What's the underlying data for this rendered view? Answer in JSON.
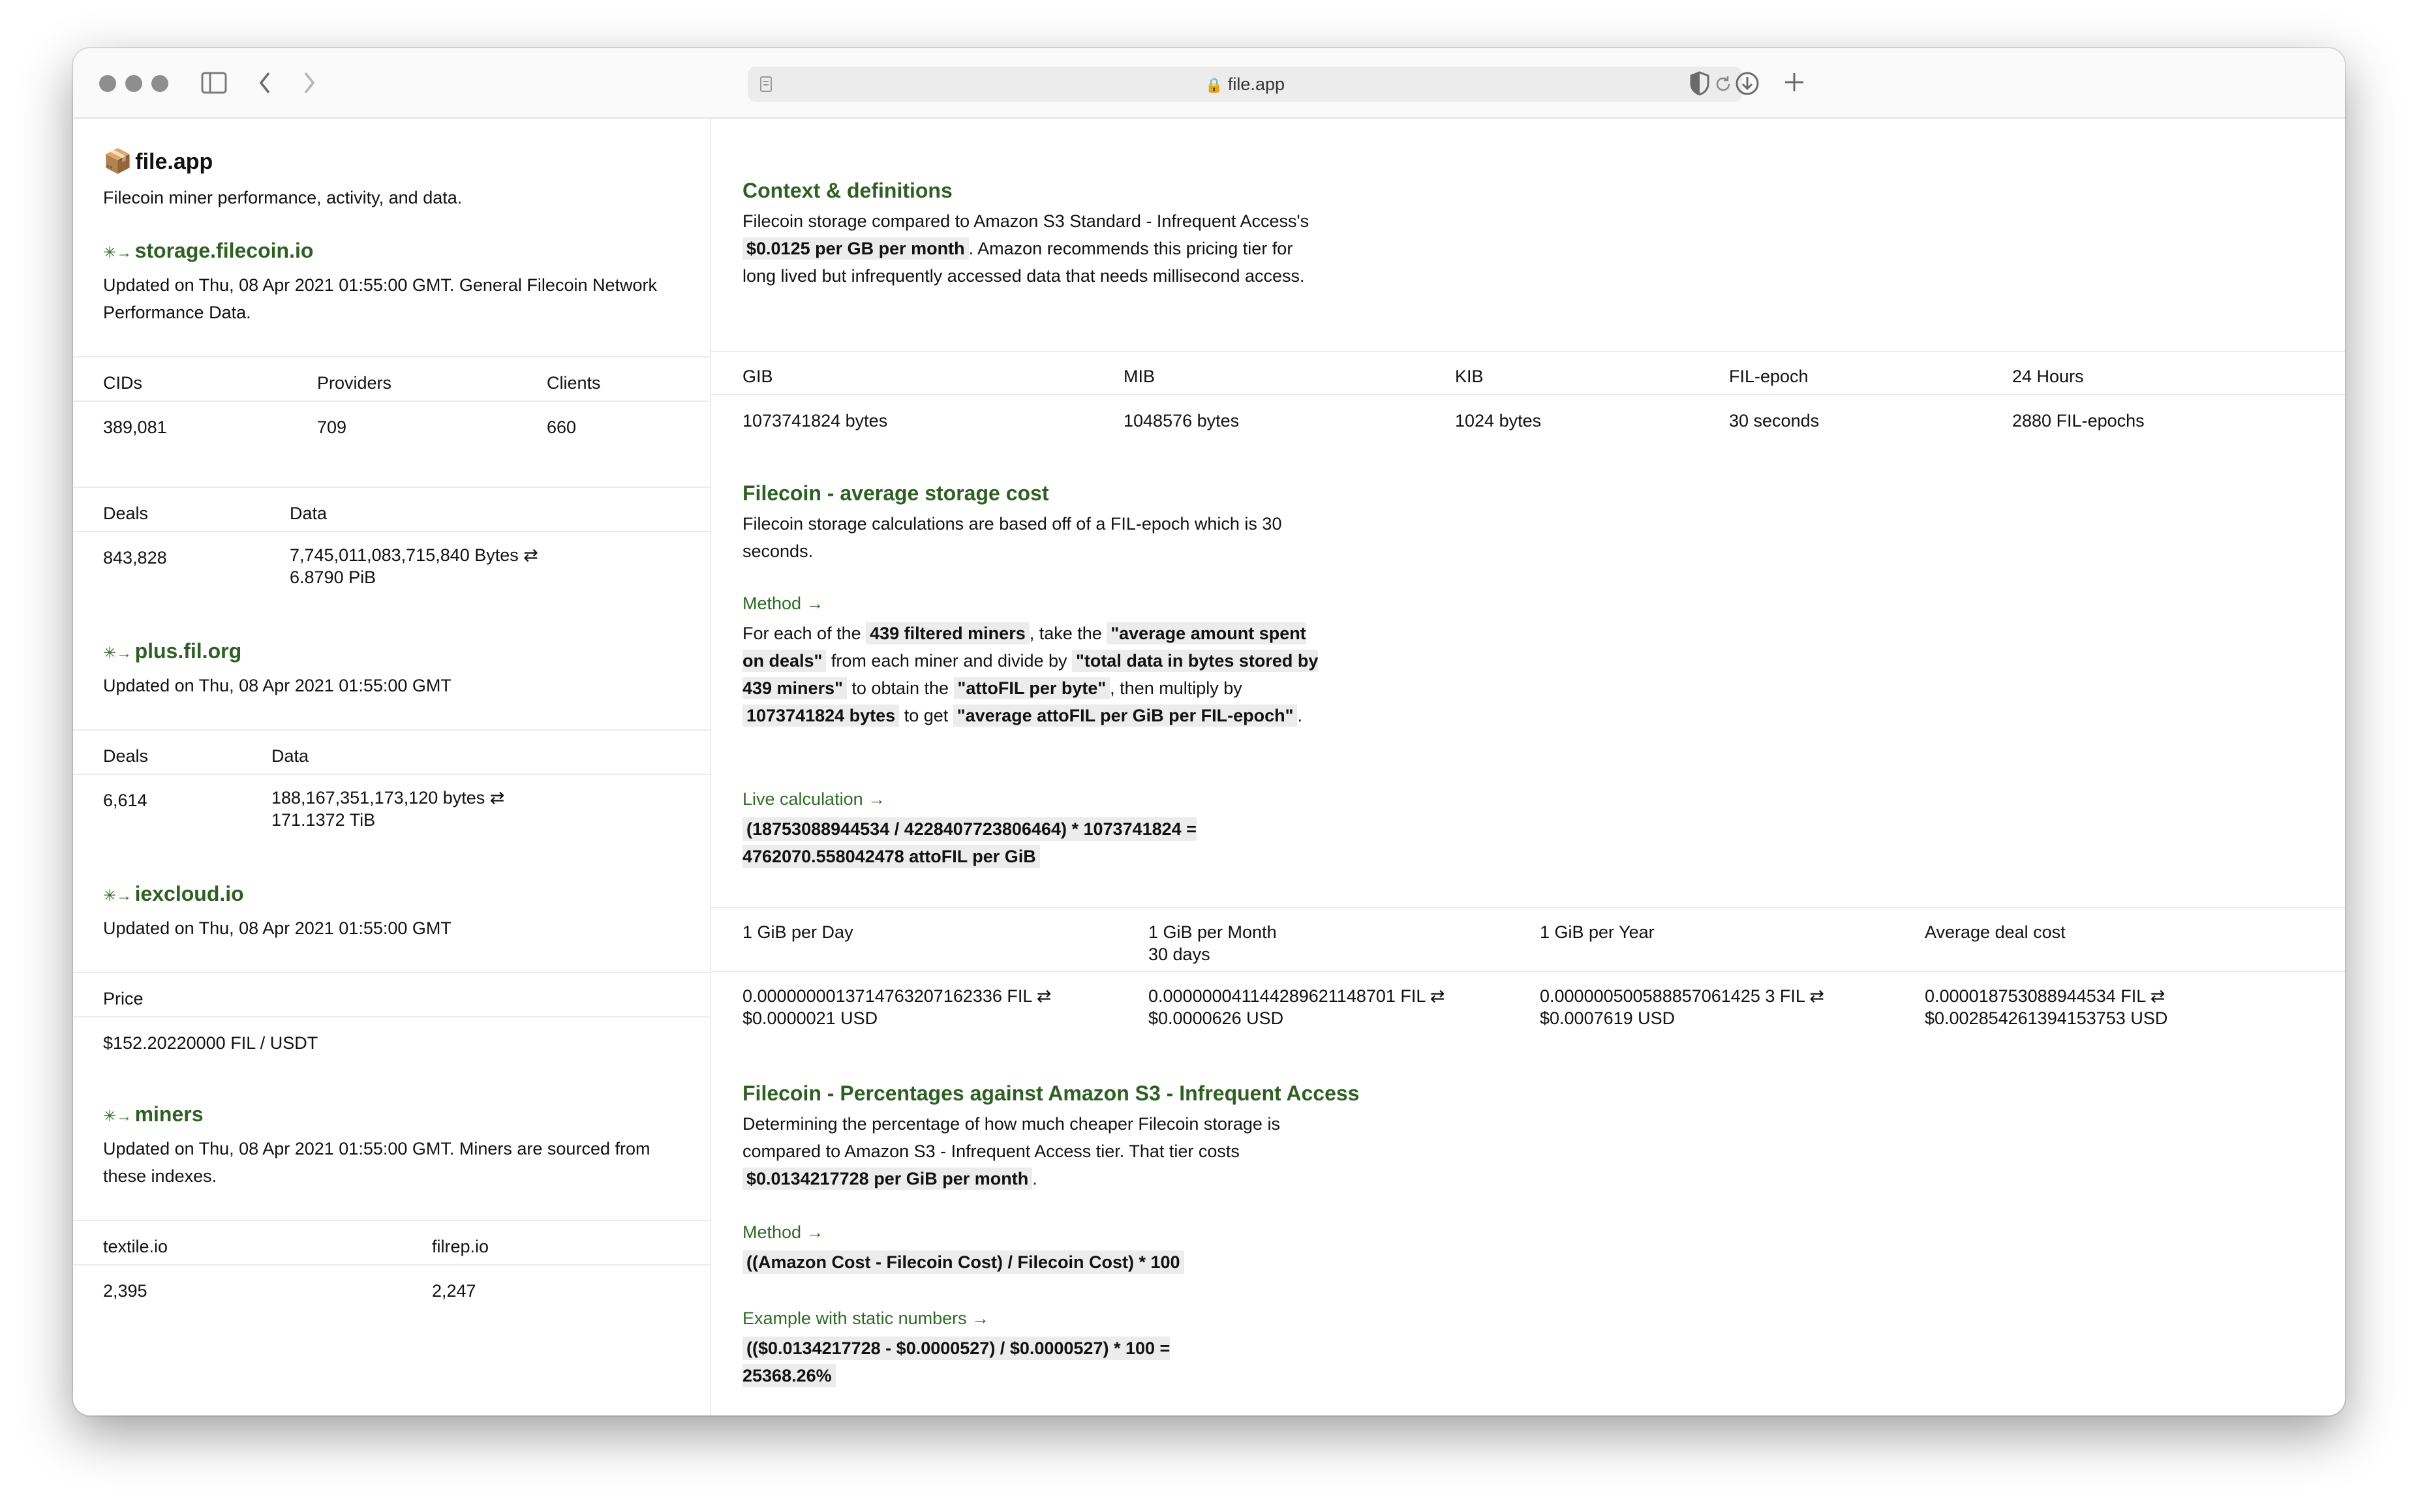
{
  "browser": {
    "url": "file.app"
  },
  "sidebar": {
    "app_title": "file.app",
    "app_subtitle": "Filecoin miner performance, activity, and data.",
    "storage": {
      "link": "storage.filecoin.io",
      "updated": "Updated on Thu, 08 Apr 2021 01:55:00 GMT. General Filecoin Network Performance Data.",
      "headers": [
        "CIDs",
        "Providers",
        "Clients"
      ],
      "values": [
        "389,081",
        "709",
        "660"
      ],
      "deals_header": "Deals",
      "data_header": "Data",
      "deals_value": "843,828",
      "data_bytes": "7,745,011,083,715,840 Bytes ⇄",
      "data_pib": "6.8790 PiB"
    },
    "plus": {
      "link": "plus.fil.org",
      "updated": "Updated on Thu, 08 Apr 2021 01:55:00 GMT",
      "deals_header": "Deals",
      "data_header": "Data",
      "deals_value": "6,614",
      "data_bytes": "188,167,351,173,120 bytes ⇄",
      "data_tib": "171.1372 TiB"
    },
    "iex": {
      "link": "iexcloud.io",
      "updated": "Updated on Thu, 08 Apr 2021 01:55:00 GMT",
      "price_header": "Price",
      "price_value": "$152.20220000 FIL / USDT"
    },
    "miners": {
      "link": "miners",
      "updated": "Updated on Thu, 08 Apr 2021 01:55:00 GMT. Miners are sourced from these indexes.",
      "headers": [
        "textile.io",
        "filrep.io"
      ],
      "values": [
        "2,395",
        "2,247"
      ]
    }
  },
  "main": {
    "context": {
      "title": "Context & definitions",
      "text_1": "Filecoin storage compared to Amazon S3 Standard - Infrequent Access's ",
      "code_1": "$0.0125 per GB per month",
      "text_2": ". Amazon recommends this pricing tier for long lived but infrequently accessed data that needs millisecond access."
    },
    "units": {
      "headers": [
        "GIB",
        "MIB",
        "KIB",
        "FIL-epoch",
        "24 Hours"
      ],
      "values": [
        "1073741824 bytes",
        "1048576 bytes",
        "1024 bytes",
        "30 seconds",
        "2880 FIL-epochs"
      ]
    },
    "avg_cost": {
      "title": "Filecoin - average storage cost",
      "text": "Filecoin storage calculations are based off of a FIL-epoch which is 30 seconds.",
      "method_label": "Method →",
      "m1": "For each of the ",
      "c1": "439 filtered miners",
      "m2": ", take the ",
      "c2": "\"average amount spent on deals\"",
      "m3": " from each miner and divide by ",
      "c3": "\"total data in bytes stored by 439 miners\"",
      "m4": " to obtain the ",
      "c4": "\"attoFIL per byte\"",
      "m5": ", then multiply by ",
      "c5": "1073741824 bytes",
      "m6": " to get ",
      "c6": "\"average attoFIL per GiB per FIL-epoch\"",
      "m7": ".",
      "live_label": "Live calculation →",
      "live_calc": "(18753088944534 / 4228407723806464) * 1073741824 = 4762070.558042478 attoFIL per GiB"
    },
    "costs": {
      "headers": [
        "1 GiB per Day",
        "1 GiB per Month",
        "1 GiB per Year",
        "Average deal cost"
      ],
      "month_sub": "30 days",
      "fil": [
        "0.0000000013714763207162336 FIL ⇄",
        "0.000000041144289621148701 FIL ⇄",
        "0.000000500588857061425 3 FIL ⇄",
        "0.000018753088944534 FIL ⇄"
      ],
      "usd": [
        "$0.0000021 USD",
        "$0.0000626 USD",
        "$0.0007619 USD",
        "$0.002854261394153753 USD"
      ]
    },
    "percent": {
      "title": "Filecoin - Percentages against Amazon S3 - Infrequent Access",
      "text_1": "Determining the percentage of how much cheaper Filecoin storage is compared to Amazon S3 - Infrequent Access tier. That tier costs ",
      "code_1": "$0.0134217728 per GiB per month",
      "text_2": ".",
      "method_label": "Method →",
      "formula": "((Amazon Cost - Filecoin Cost) / Filecoin Cost) * 100",
      "example_label": "Example with static numbers →",
      "example": "(($0.0134217728 - $0.0000527) / $0.0000527) * 100 = 25368.26%"
    }
  }
}
